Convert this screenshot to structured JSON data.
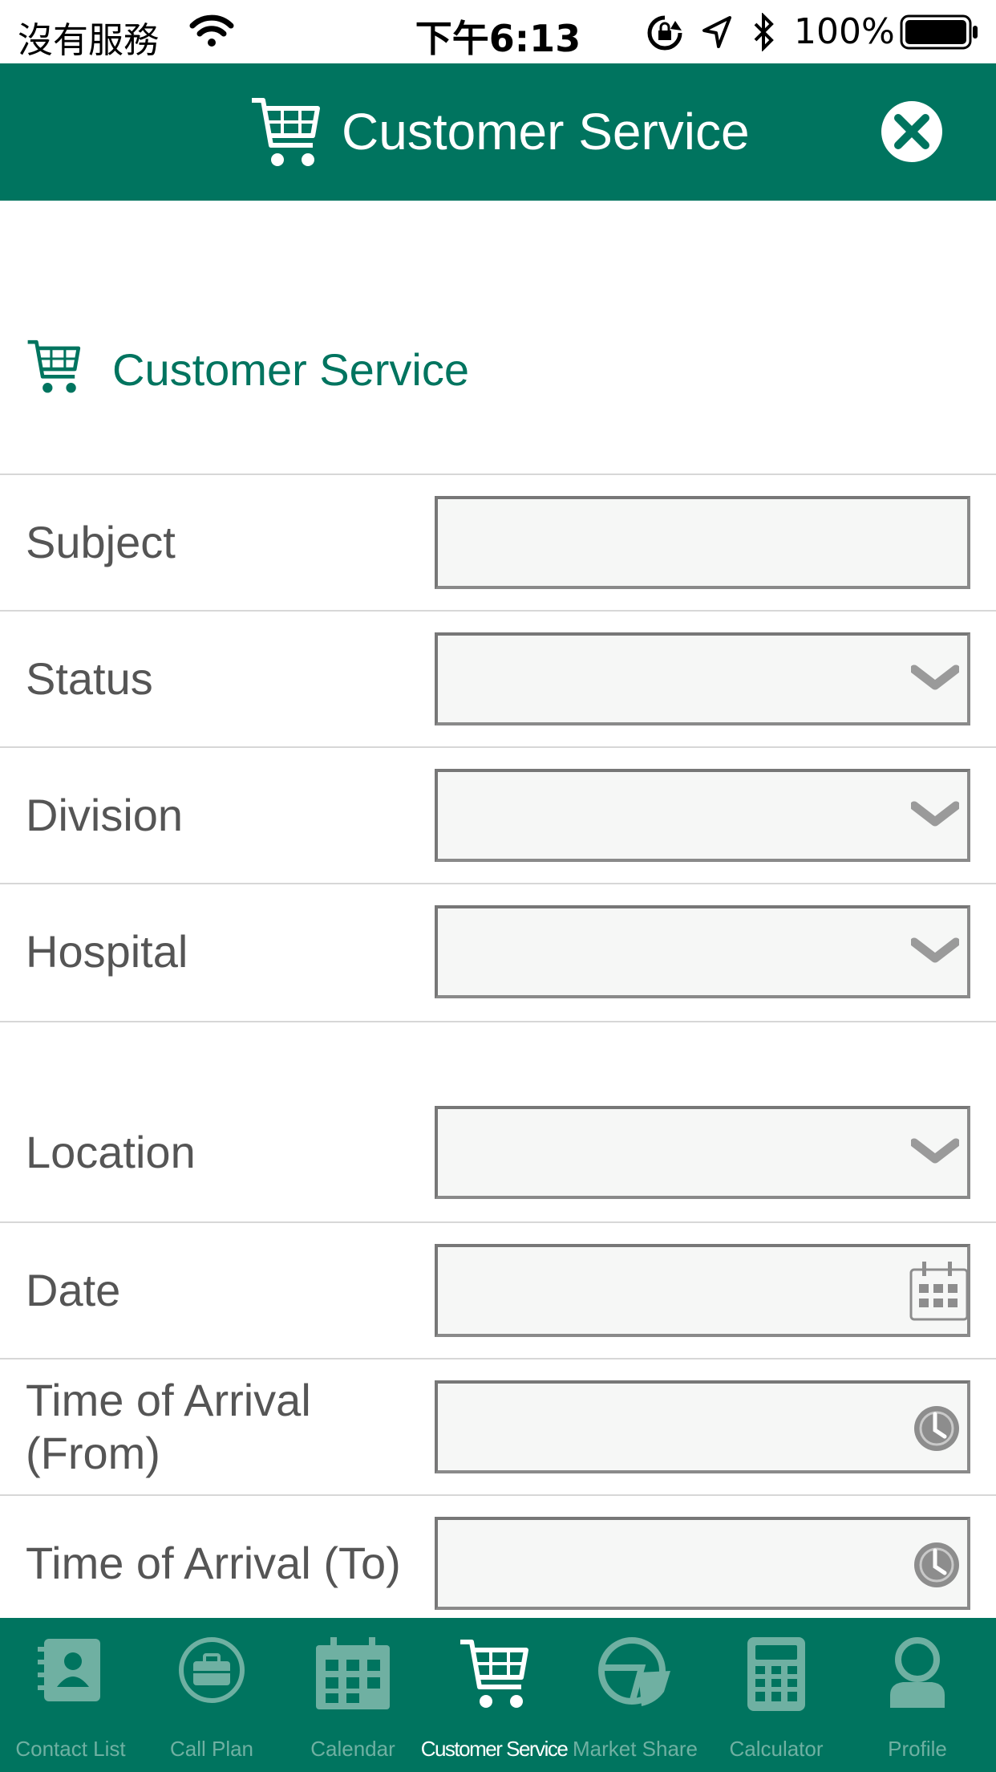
{
  "status_bar": {
    "carrier": "沒有服務",
    "time": "下午6:13",
    "battery_percent": "100%"
  },
  "header": {
    "title": "Customer Service",
    "icon": "cart-icon",
    "close_icon": "close-icon"
  },
  "section": {
    "title": "Customer Service",
    "icon": "cart-icon"
  },
  "form": {
    "subject": {
      "label": "Subject",
      "value": ""
    },
    "status": {
      "label": "Status",
      "value": ""
    },
    "division": {
      "label": "Division",
      "value": ""
    },
    "hospital": {
      "label": "Hospital",
      "value": ""
    },
    "location": {
      "label": "Location",
      "value": ""
    },
    "date": {
      "label": "Date",
      "value": ""
    },
    "time_from": {
      "label": "Time of Arrival (From)",
      "value": ""
    },
    "time_to": {
      "label": "Time of Arrival (To)",
      "value": ""
    }
  },
  "tabs": [
    {
      "label": "Contact List",
      "icon": "contact-list-icon",
      "active": false
    },
    {
      "label": "Call Plan",
      "icon": "briefcase-icon",
      "active": false
    },
    {
      "label": "Calendar",
      "icon": "calendar-icon",
      "active": false
    },
    {
      "label": "Customer Service",
      "icon": "cart-icon",
      "active": true
    },
    {
      "label": "Market Share",
      "icon": "pie-chart-icon",
      "active": false
    },
    {
      "label": "Calculator",
      "icon": "calculator-icon",
      "active": false
    },
    {
      "label": "Profile",
      "icon": "profile-icon",
      "active": false
    }
  ],
  "colors": {
    "brand": "#00745f",
    "tab_inactive": "#6fb0a2",
    "label_text": "#555555"
  }
}
